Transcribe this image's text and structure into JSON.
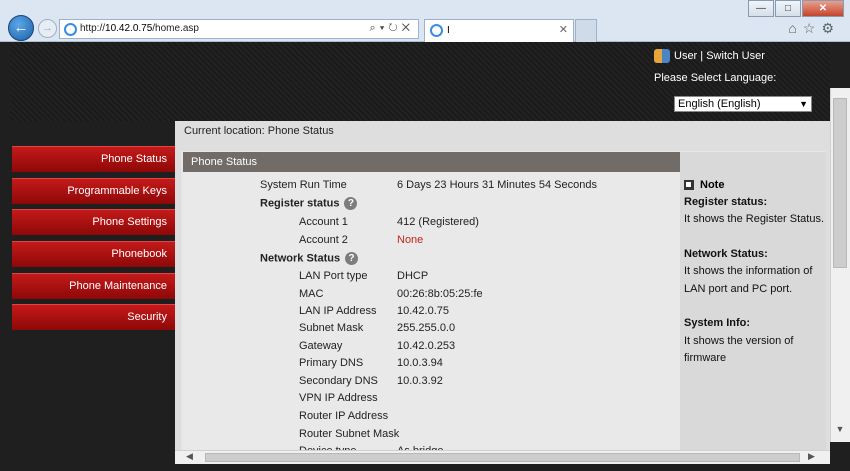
{
  "browser": {
    "url_prefix": "http://",
    "url_host": "10.42.0.75",
    "url_path": "/home.asp",
    "tab_title": "I",
    "win_min": "—",
    "win_max": "□",
    "win_close": "✕"
  },
  "header": {
    "user_link": "User",
    "separator": " | ",
    "switch_user": "Switch User",
    "language_label": "Please Select Language:",
    "language_value": "English (English)"
  },
  "sidebar": {
    "items": [
      {
        "label": "Phone Status"
      },
      {
        "label": "Programmable Keys"
      },
      {
        "label": "Phone Settings"
      },
      {
        "label": "Phonebook"
      },
      {
        "label": "Phone Maintenance"
      },
      {
        "label": "Security"
      }
    ]
  },
  "main": {
    "location": "Current location: Phone Status",
    "panel_title": "Phone Status",
    "system_run_time_label": "System Run Time",
    "system_run_time_value": "6 Days 23 Hours 31 Minutes 54 Seconds",
    "register_status_heading": "Register status",
    "account1_label": "Account 1",
    "account1_value": "412 (Registered)",
    "account2_label": "Account 2",
    "account2_value": "None",
    "network_status_heading": "Network Status",
    "network": [
      {
        "label": "LAN Port type",
        "value": "DHCP"
      },
      {
        "label": "MAC",
        "value": "00:26:8b:05:25:fe"
      },
      {
        "label": "LAN IP Address",
        "value": "10.42.0.75"
      },
      {
        "label": "Subnet Mask",
        "value": "255.255.0.0"
      },
      {
        "label": "Gateway",
        "value": "10.42.0.253"
      },
      {
        "label": "Primary DNS",
        "value": "10.0.3.94"
      },
      {
        "label": "Secondary DNS",
        "value": "10.0.3.92"
      },
      {
        "label": "VPN IP Address",
        "value": ""
      },
      {
        "label": "Router IP Address",
        "value": ""
      },
      {
        "label": "Router Subnet Mask",
        "value": ""
      },
      {
        "label": "Device type",
        "value": "As bridge"
      }
    ]
  },
  "note": {
    "title": "Note",
    "lines": [
      {
        "text": "Register status:",
        "bold": true
      },
      {
        "text": "It shows the Register Status.",
        "bold": false
      },
      {
        "text": "Network Status:",
        "bold": true
      },
      {
        "text": "It shows the information of",
        "bold": false
      },
      {
        "text": "LAN port and PC port.",
        "bold": false
      },
      {
        "text": "System Info:",
        "bold": true
      },
      {
        "text": "It shows the version of",
        "bold": false
      },
      {
        "text": "firmware",
        "bold": false
      }
    ]
  }
}
